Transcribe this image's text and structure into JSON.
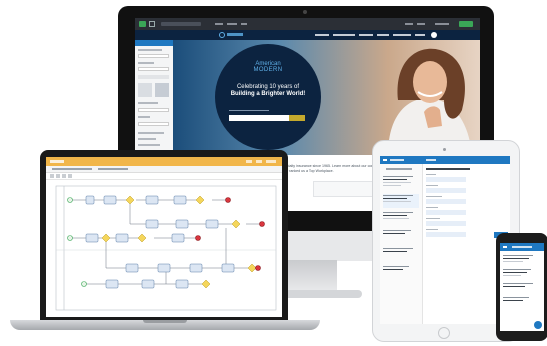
{
  "monitor": {
    "site": {
      "logo_line1": "American",
      "logo_line2": "MODERN",
      "hero_heading_line1": "Celebrating 10 years of",
      "hero_heading_line2": "Building a Brighter World!",
      "banner_text_line1": "American Modern has been offering specialty insurance since 1965. Learn more about our company",
      "banner_text_line2": "Employer ranked us a Top Workplace."
    }
  },
  "colors": {
    "navy": "#0c2340",
    "editor_dark": "#2b2f36",
    "bpmn_task": "#dce6f3",
    "bpmn_gateway": "#f5d65b",
    "bpmn_end": "#d9363e",
    "accent_green": "#3aa757",
    "app_blue": "#1f78c1"
  }
}
